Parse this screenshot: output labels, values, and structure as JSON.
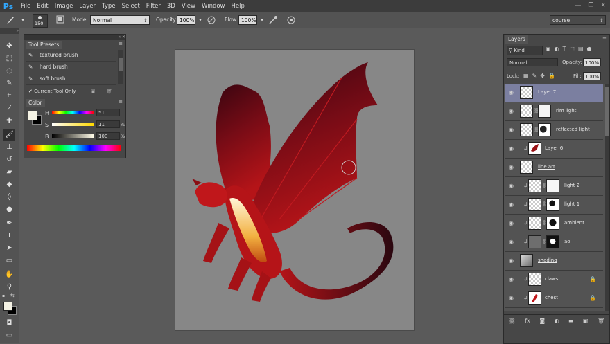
{
  "app": {
    "logo": "Ps"
  },
  "menu": [
    "File",
    "Edit",
    "Image",
    "Layer",
    "Type",
    "Select",
    "Filter",
    "3D",
    "View",
    "Window",
    "Help"
  ],
  "window_controls": [
    "—",
    "❐",
    "✕"
  ],
  "options": {
    "brush_size": "150",
    "mode_label": "Mode:",
    "mode_value": "Normal",
    "opacity_label": "Opacity:",
    "opacity_value": "100%",
    "flow_label": "Flow:",
    "flow_value": "100%",
    "workspace": "course"
  },
  "tool_presets": {
    "title": "Tool Presets",
    "items": [
      "textured brush",
      "hard brush",
      "soft brush"
    ],
    "current_tool_only": "Current Tool Only"
  },
  "color_panel": {
    "title": "Color",
    "h_label": "H",
    "h_value": "51",
    "s_label": "S",
    "s_value": "11",
    "s_unit": "%",
    "b_label": "B",
    "b_value": "100",
    "b_unit": "%"
  },
  "layers": {
    "title": "Layers",
    "filter_kind": "Kind",
    "blend_mode": "Normal",
    "opacity_label": "Opacity:",
    "opacity_value": "100%",
    "lock_label": "Lock:",
    "fill_label": "Fill:",
    "fill_value": "100%",
    "rows": [
      {
        "name": "Layer 7"
      },
      {
        "name": "rim light"
      },
      {
        "name": "reflected light"
      },
      {
        "name": "Layer 6"
      },
      {
        "name": "line art"
      },
      {
        "name": "light 2"
      },
      {
        "name": "light 1"
      },
      {
        "name": "ambient"
      },
      {
        "name": "ao"
      },
      {
        "name": "shading"
      },
      {
        "name": "claws"
      },
      {
        "name": "chest"
      }
    ],
    "footer_icons": [
      "link-icon",
      "fx-icon",
      "mask-icon",
      "adjustment-icon",
      "folder-icon",
      "new-layer-icon",
      "trash-icon"
    ]
  },
  "colors": {
    "accent_selected_layer": "#7b7fa0",
    "foreground": "#f4f2e4",
    "background": "#000000",
    "dragon_red": "#b01010"
  }
}
